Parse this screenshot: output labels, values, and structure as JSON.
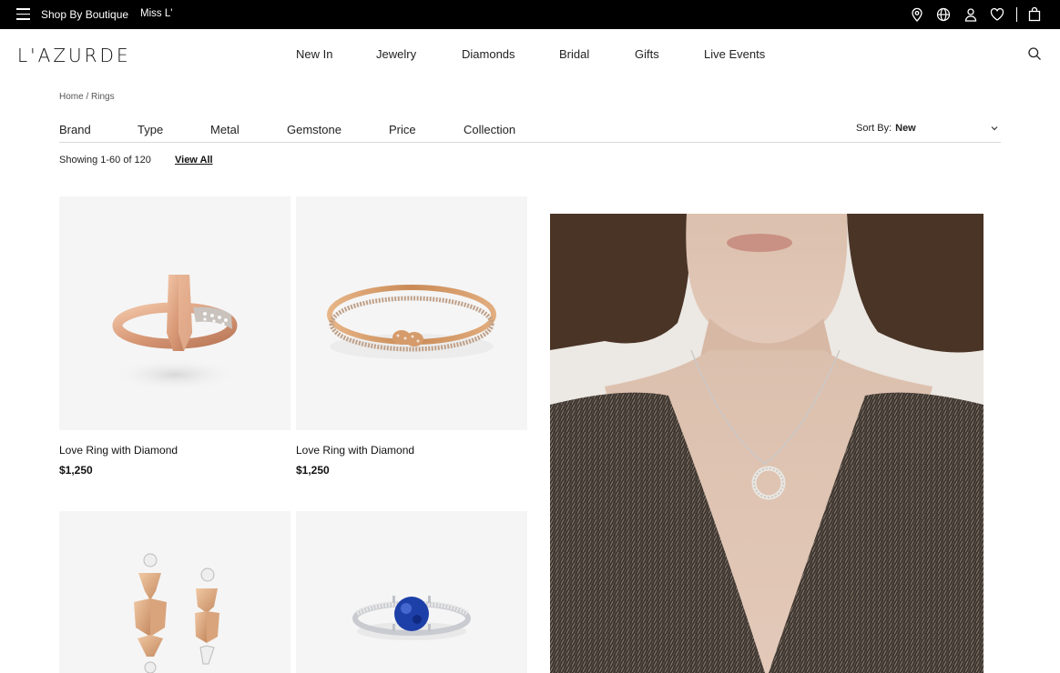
{
  "topbar": {
    "shop_by_boutique": "Shop By Boutique",
    "brand_link": "Miss L'"
  },
  "header": {
    "logo": "L'AZURDE",
    "nav": [
      "New In",
      "Jewelry",
      "Diamonds",
      "Bridal",
      "Gifts",
      "Live Events"
    ]
  },
  "breadcrumb": "Home / Rings",
  "filters": {
    "items": [
      "Brand",
      "Type",
      "Metal",
      "Gemstone",
      "Price",
      "Collection"
    ],
    "sort_label": "Sort By:",
    "sort_value": "New"
  },
  "results": {
    "showing": "Showing 1-60 of 120",
    "view_all": "View All"
  },
  "products": [
    {
      "name": "Love Ring with Diamond",
      "price": "$1,250"
    },
    {
      "name": "Love Ring with Diamond",
      "price": "$1,250"
    },
    {
      "name": "",
      "price": ""
    },
    {
      "name": "",
      "price": ""
    }
  ],
  "colors": {
    "topbar_bg": "#000000",
    "card_bg": "#f5f5f5",
    "rose_gold": "#d9a07e",
    "sapphire": "#1d3fa8"
  }
}
